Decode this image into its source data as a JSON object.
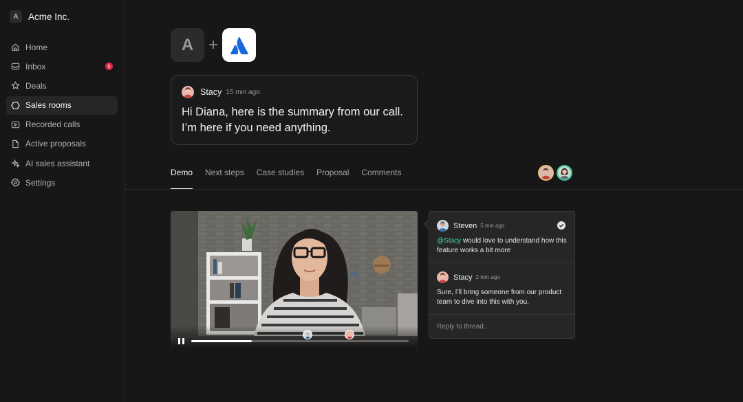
{
  "org": {
    "badge": "A",
    "name": "Acme Inc."
  },
  "nav": {
    "items": [
      {
        "label": "Home",
        "icon": "home-icon"
      },
      {
        "label": "Inbox",
        "icon": "inbox-icon",
        "badge": "5"
      },
      {
        "label": "Deals",
        "icon": "star-icon"
      },
      {
        "label": "Sales rooms",
        "icon": "hexagon-icon",
        "active": true
      },
      {
        "label": "Recorded calls",
        "icon": "video-icon"
      },
      {
        "label": "Active proposals",
        "icon": "document-icon"
      },
      {
        "label": "AI sales assistant",
        "icon": "sparkle-icon"
      },
      {
        "label": "Settings",
        "icon": "gear-icon"
      }
    ]
  },
  "logos": {
    "company_letter": "A",
    "plus": "+",
    "partner_icon": "atlassian-logo-icon"
  },
  "message": {
    "author": "Stacy",
    "time": "15 min ago",
    "body": "Hi Diana, here is the summary from our call. I’m here if you need anything."
  },
  "tabs": [
    {
      "label": "Demo",
      "active": true
    },
    {
      "label": "Next steps"
    },
    {
      "label": "Case studies"
    },
    {
      "label": "Proposal"
    },
    {
      "label": "Comments"
    }
  ],
  "video": {
    "progress": 0.28,
    "state": "playing"
  },
  "thread": {
    "comments": [
      {
        "author": "Steven",
        "time": "5 min ago",
        "mention": "@Stacy",
        "body": " would love to understand how this feature works a bit more"
      },
      {
        "author": "Stacy",
        "time": "2 min ago",
        "body": "Sure, I’ll bring someone from our product team to dive into this with you."
      }
    ],
    "reply_placeholder": "Reply to thread..."
  },
  "colors": {
    "background": "#171717",
    "accent_mention": "#3ed6b0",
    "badge": "#e2294a",
    "atlassian_blue": "#1868db"
  }
}
